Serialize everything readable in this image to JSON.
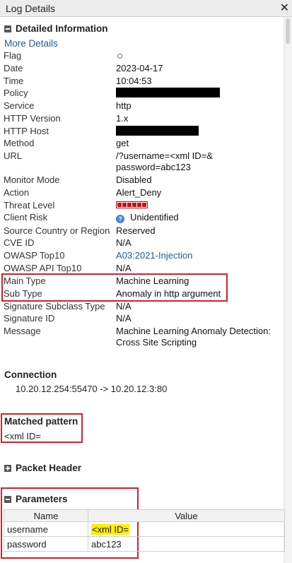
{
  "window": {
    "title": "Log Details",
    "close_icon": "✕"
  },
  "detailed_info": {
    "heading": "Detailed Information",
    "more_details": "More Details",
    "fields": {
      "flag": {
        "label": "Flag"
      },
      "date": {
        "label": "Date",
        "value": "2023-04-17"
      },
      "time": {
        "label": "Time",
        "value": "10:04:53"
      },
      "policy": {
        "label": "Policy"
      },
      "service": {
        "label": "Service",
        "value": "http"
      },
      "http_version": {
        "label": "HTTP Version",
        "value": "1.x"
      },
      "http_host": {
        "label": "HTTP Host"
      },
      "method": {
        "label": "Method",
        "value": "get"
      },
      "url": {
        "label": "URL",
        "value_line1": "/?username=<xml ID=&",
        "value_line2": "password=abc123"
      },
      "monitor_mode": {
        "label": "Monitor Mode",
        "value": "Disabled"
      },
      "action": {
        "label": "Action",
        "value": "Alert_Deny"
      },
      "threat_level": {
        "label": "Threat Level",
        "level": 6,
        "max": 6
      },
      "client_risk": {
        "label": "Client Risk",
        "value": "Unidentified"
      },
      "source_country": {
        "label": "Source Country or Region",
        "value": "Reserved"
      },
      "cve_id": {
        "label": "CVE ID",
        "value": "N/A"
      },
      "owasp_top10": {
        "label": "OWASP Top10",
        "value": "A03:2021-Injection"
      },
      "owasp_api_top10": {
        "label": "OWASP API Top10",
        "value": "N/A"
      },
      "main_type": {
        "label": "Main Type",
        "value": "Machine Learning"
      },
      "sub_type": {
        "label": "Sub Type",
        "value": "Anomaly in http argument"
      },
      "signature_subclass": {
        "label": "Signature Subclass Type",
        "value": "N/A"
      },
      "signature_id": {
        "label": "Signature ID",
        "value": "N/A"
      },
      "message": {
        "label": "Message",
        "value_line1": "Machine Learning Anomaly Detection:",
        "value_line2": "Cross Site Scripting"
      }
    }
  },
  "connection": {
    "heading": "Connection",
    "value": "10.20.12.254:55470 -> 10.20.12.3:80"
  },
  "matched_pattern": {
    "heading": "Matched pattern",
    "value": "<xml ID="
  },
  "packet_header": {
    "heading": "Packet Header"
  },
  "parameters": {
    "heading": "Parameters",
    "columns": [
      "Name",
      "Value"
    ],
    "rows": [
      {
        "name": "username",
        "value": "<xml ID="
      },
      {
        "name": "password",
        "value": "abc123"
      }
    ]
  },
  "colors": {
    "highlight_box": "#d81e2a",
    "link": "#1f5c99",
    "threat": "#c3141a",
    "value_highlight": "#ffee00"
  }
}
